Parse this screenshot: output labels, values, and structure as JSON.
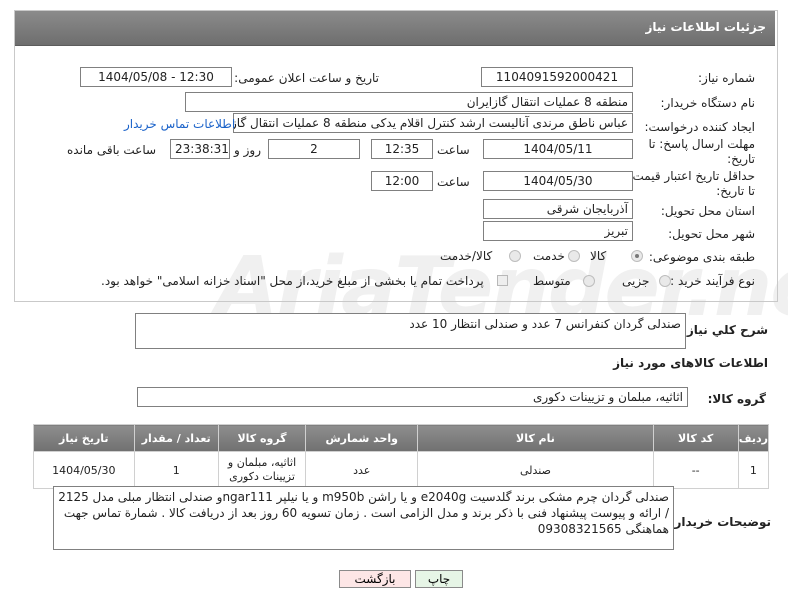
{
  "header": {
    "title": "جزئیات اطلاعات نیاز"
  },
  "fields": {
    "need_number": {
      "label": "شماره نیاز:",
      "value": "1104091592000421"
    },
    "announce_datetime": {
      "label": "تاریخ و ساعت اعلان عمومی:",
      "value": "1404/05/08 - 12:30"
    },
    "buyer_org": {
      "label": "نام دستگاه خریدار:",
      "value": "منطقه 8 عملیات انتقال گازایران"
    },
    "requester": {
      "label": "ایجاد کننده درخواست:",
      "value": "عباس ناطق مرندی آنالیست ارشد کنترل اقلام یدکی منطقه 8 عملیات انتقال گاز",
      "contact_link": "اطلاعات تماس خریدار"
    },
    "reply_deadline": {
      "label_line1": "مهلت ارسال پاسخ: تا",
      "label_line2": "تاریخ:",
      "date": "1404/05/11",
      "time_label": "ساعت",
      "time": "12:35",
      "days": "2",
      "days_label": "روز و",
      "remaining": "23:38:31",
      "remaining_label": "ساعت باقی مانده"
    },
    "price_validity": {
      "label_line1": "حداقل تاریخ اعتبار قیمت:",
      "label_line2": "تا تاریخ:",
      "date": "1404/05/30",
      "time_label": "ساعت",
      "time": "12:00"
    },
    "delivery_province": {
      "label": "استان محل تحویل:",
      "value": "آذربایجان شرقی"
    },
    "delivery_city": {
      "label": "شهر محل تحویل:",
      "value": "تبریز"
    },
    "category": {
      "label": "طبقه بندی موضوعی:",
      "options": [
        "کالا",
        "خدمت",
        "کالا/خدمت"
      ],
      "selected": "کالا"
    },
    "purchase_type": {
      "label": "نوع فرآیند خرید :",
      "options": [
        "جزیی",
        "متوسط"
      ],
      "treasury_note": "پرداخت تمام یا بخشی از مبلغ خرید،از محل \"اسناد خزانه اسلامی\" خواهد بود."
    },
    "general_description": {
      "label": "شرح کلي نياز:",
      "value": "صندلی گردان کنفرانس 7 عدد و صندلی انتظار 10 عدد"
    }
  },
  "goods": {
    "section_title": "اطلاعات کالاهای مورد نیاز",
    "group_label": "گروه کالا:",
    "group_value": "اثاثیه، مبلمان و تزیینات دکوری",
    "columns": [
      "ردیف",
      "کد کالا",
      "نام کالا",
      "واحد شمارش",
      "گروه کالا",
      "تعداد / مقدار",
      "تاریخ نیاز"
    ],
    "rows": [
      [
        "1",
        "--",
        "صندلی",
        "عدد",
        "اثاثیه، مبلمان و تزیینات دکوری",
        "1",
        "1404/05/30"
      ]
    ]
  },
  "buyer_notes": {
    "label": "توضیحات خریدار:",
    "value": "صندلی گردان چرم مشکی برند گلدسیت e2040g و یا راشن m950b و یا نیلپر ngar111و صندلی انتظار مبلی مدل 2125 / ارائه و پیوست پیشنهاد فنی با ذکر برند و مدل الزامی است . زمان تسویه 60 روز بعد از دریافت کالا . شمارة تماس جهت هماهنگی 09308321565"
  },
  "buttons": {
    "print": "چاپ",
    "back": "بازگشت"
  },
  "watermark": "AriaTender.neT"
}
